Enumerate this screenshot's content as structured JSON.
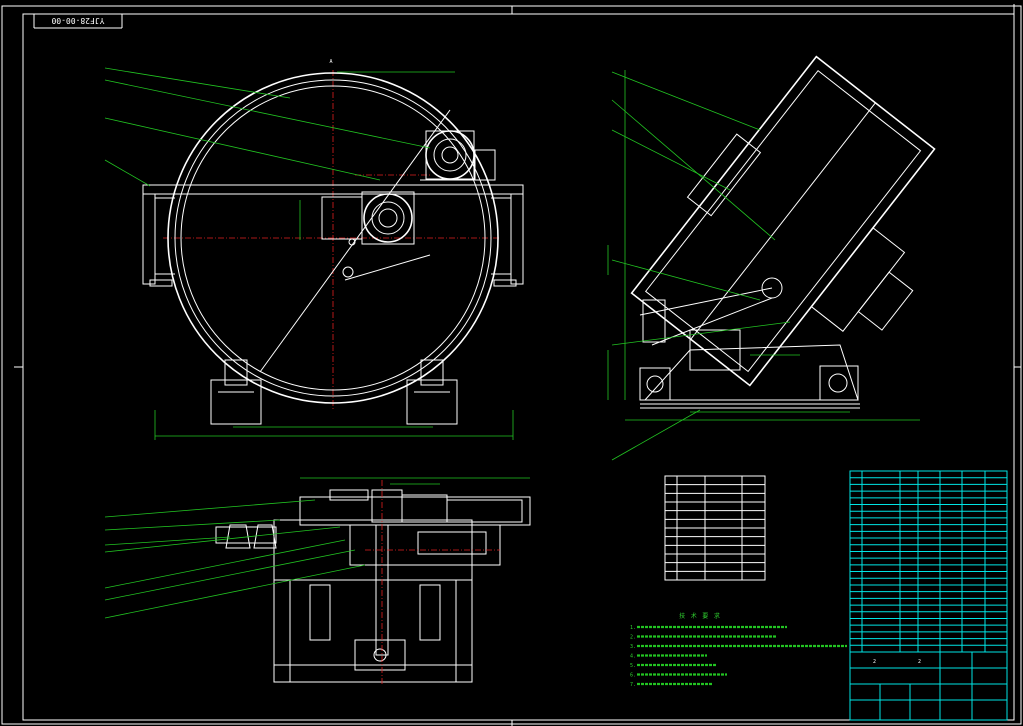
{
  "drawing": {
    "drawing_number": "YJF28-00-00",
    "section_marker": "A",
    "colors": {
      "background": "#000000",
      "frame": "#ffffff",
      "outline": "#ffffff",
      "dimension": "#22c422",
      "centerline": "#e02020",
      "table_grid": "#00e5e5"
    }
  },
  "notes": {
    "title": "技 术 要 求",
    "lines": [
      "1.",
      "2.",
      "3.",
      "4.",
      "5.",
      "6.",
      "7."
    ]
  },
  "tech_table": {
    "rows": 12
  },
  "parts_list": {
    "rows": 27
  },
  "title_block": {
    "scale_marks": [
      "2",
      "2"
    ],
    "cells": [
      "",
      "",
      ""
    ]
  }
}
